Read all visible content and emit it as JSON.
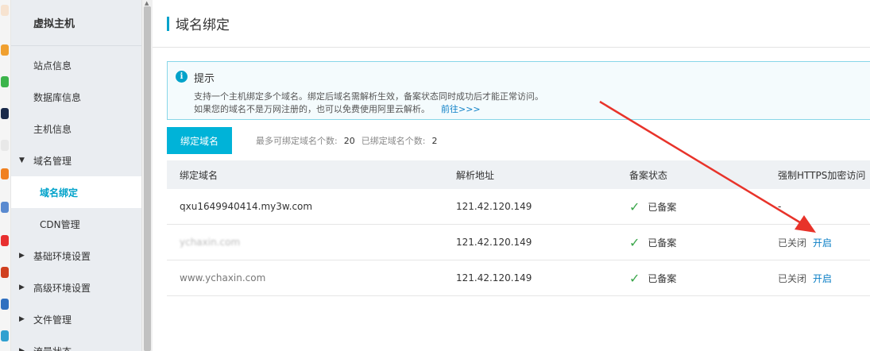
{
  "sidebar": {
    "title": "虚拟主机",
    "items": [
      {
        "label": "站点信息"
      },
      {
        "label": "数据库信息"
      },
      {
        "label": "主机信息"
      },
      {
        "label": "域名管理"
      },
      {
        "label": "域名绑定"
      },
      {
        "label": "CDN管理"
      },
      {
        "label": "基础环境设置"
      },
      {
        "label": "高级环境设置"
      },
      {
        "label": "文件管理"
      },
      {
        "label": "流量状态"
      }
    ]
  },
  "page": {
    "title": "域名绑定"
  },
  "notice": {
    "title": "提示",
    "line1": "支持一个主机绑定多个域名。绑定后域名需解析生效，备案状态同时成功后才能正常访问。",
    "line2": "如果您的域名不是万网注册的，也可以免费使用阿里云解析。",
    "link": "前往>>>"
  },
  "toolbar": {
    "bind_button": "绑定域名",
    "max_label": "最多可绑定域名个数:",
    "max_value": "20",
    "bound_label": "已绑定域名个数:",
    "bound_value": "2"
  },
  "table": {
    "headers": [
      "绑定域名",
      "解析地址",
      "备案状态",
      "强制HTTPS加密访问"
    ],
    "rows": [
      {
        "domain": "qxu1649940414.my3w.com",
        "ip": "121.42.120.149",
        "status": "已备案",
        "https_off": "",
        "https_on": "",
        "https_dash": "-"
      },
      {
        "domain": "ychaxin.com",
        "ip": "121.42.120.149",
        "status": "已备案",
        "https_off": "已关闭",
        "https_on": "开启"
      },
      {
        "domain": "www.ychaxin.com",
        "ip": "121.42.120.149",
        "status": "已备案",
        "https_off": "已关闭",
        "https_on": "开启"
      }
    ]
  },
  "colors": {
    "accent": "#00a2ca",
    "button": "#00b3d8",
    "arrow": "#e8332a",
    "check": "#3aa64a"
  }
}
